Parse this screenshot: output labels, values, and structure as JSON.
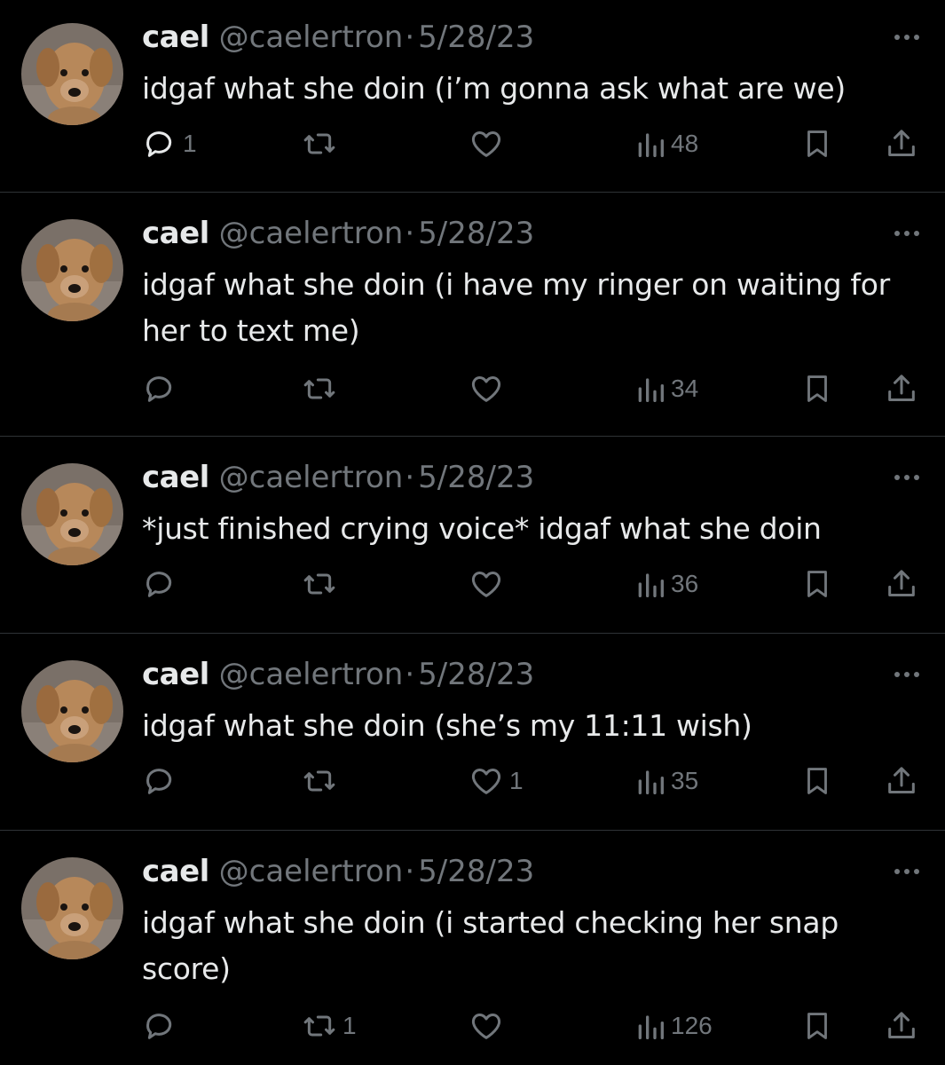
{
  "tweets": [
    {
      "name": "cael",
      "handle": "@caelertron",
      "separator": "·",
      "date": "5/28/23",
      "text": "idgaf what she doin (i’m gonna ask what are we)",
      "replies": "1",
      "retweets": "",
      "likes": "",
      "views": "48"
    },
    {
      "name": "cael",
      "handle": "@caelertron",
      "separator": "·",
      "date": "5/28/23",
      "text": "idgaf what she doin (i have my ringer on waiting for her to text me)",
      "replies": "",
      "retweets": "",
      "likes": "",
      "views": "34"
    },
    {
      "name": "cael",
      "handle": "@caelertron",
      "separator": "·",
      "date": "5/28/23",
      "text": "*just finished crying voice* idgaf what she doin",
      "replies": "",
      "retweets": "",
      "likes": "",
      "views": "36"
    },
    {
      "name": "cael",
      "handle": "@caelertron",
      "separator": "·",
      "date": "5/28/23",
      "text": "idgaf what she doin (she’s my 11:11 wish)",
      "replies": "",
      "retweets": "",
      "likes": "1",
      "views": "35"
    },
    {
      "name": "cael",
      "handle": "@caelertron",
      "separator": "·",
      "date": "5/28/23",
      "text": "idgaf what she doin (i started checking her snap score)",
      "replies": "",
      "retweets": "1",
      "likes": "",
      "views": "126"
    }
  ],
  "icons": {
    "reply": "reply-icon",
    "retweet": "retweet-icon",
    "like": "heart-icon",
    "views": "views-icon",
    "bookmark": "bookmark-icon",
    "share": "share-icon",
    "more": "more-icon"
  },
  "colors": {
    "background": "#000000",
    "text": "#e7e9ea",
    "secondary": "#71767b",
    "divider": "#2f3336"
  }
}
